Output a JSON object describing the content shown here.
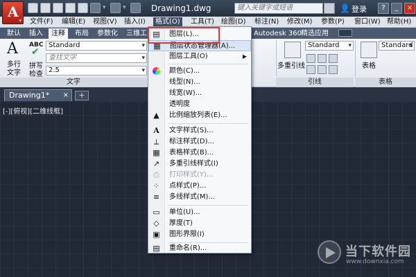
{
  "titlebar": {
    "doc_title": "Drawing1.dwg",
    "search_placeholder": "键入关键字或短语",
    "login_label": "登录"
  },
  "menubar": {
    "items": [
      "文件(F)",
      "编辑(E)",
      "视图(V)",
      "插入(I)",
      "格式(O)",
      "工具(T)",
      "绘图(D)",
      "标注(N)",
      "修改(M)",
      "参数(P)",
      "窗口(W)",
      "帮助(H)"
    ],
    "active": "格式(O)"
  },
  "ribbon_tabs": {
    "items": [
      "默认",
      "插入",
      "注释",
      "布局",
      "参数化",
      "三维工具",
      "Autodesk 360",
      "精选应用"
    ],
    "active": "注释"
  },
  "ribbon": {
    "text_panel": {
      "title": "文字",
      "multiline_label_1": "多行",
      "multiline_label_2": "文字",
      "spell_label_1": "拼写",
      "spell_label_2": "检查",
      "abc": "ABC",
      "style_value": "Standard",
      "find_placeholder": "查找文字",
      "height_value": "2.5"
    },
    "leader_panel": {
      "title": "引线",
      "style_value": "Standard",
      "multileader_label": "多重引线"
    },
    "table_panel": {
      "title": "表格",
      "style_value": "Standard",
      "table_label": "表格"
    }
  },
  "doc_tabs": {
    "active_tab": "Drawing1*"
  },
  "viewport_label": "[-][俯视][二维线框]",
  "format_menu": {
    "items": [
      {
        "label": "图层(L)...",
        "icon": "layer-icon"
      },
      {
        "label": "图层状态管理器(A)...",
        "icon": "layer-state-icon",
        "hover": true
      },
      {
        "label": "图层工具(O)",
        "icon": "layer-tools-icon",
        "submenu": true
      },
      {
        "label": "颜色(C)...",
        "icon": "color-wheel-icon"
      },
      {
        "label": "线型(N)...",
        "icon": ""
      },
      {
        "label": "线宽(W)...",
        "icon": ""
      },
      {
        "label": "透明度",
        "icon": ""
      },
      {
        "label": "比例缩放列表(E)...",
        "icon": "scale-list-icon"
      },
      {
        "label": "文字样式(S)...",
        "icon": "text-style-icon"
      },
      {
        "label": "标注样式(D)...",
        "icon": "dim-style-icon"
      },
      {
        "label": "表格样式(B)...",
        "icon": "table-style-icon"
      },
      {
        "label": "多重引线样式(I)",
        "icon": "mleader-style-icon"
      },
      {
        "label": "打印样式(Y)...",
        "icon": "plot-style-icon",
        "disabled": true
      },
      {
        "label": "点样式(P)...",
        "icon": "point-style-icon"
      },
      {
        "label": "多线样式(M)...",
        "icon": "mline-style-icon"
      },
      {
        "label": "单位(U)...",
        "icon": "units-icon"
      },
      {
        "label": "厚度(T)",
        "icon": "thickness-icon"
      },
      {
        "label": "图形界限(I)",
        "icon": "limits-icon"
      },
      {
        "label": "重命名(R)...",
        "icon": "rename-icon"
      }
    ]
  },
  "watermark": {
    "name": "当下软件园",
    "url": "www.downxia.com"
  },
  "colors": {
    "highlight_border": "#e03a3a",
    "canvas_bg": "#212836",
    "menu_active_bg": "#3e4d63"
  }
}
